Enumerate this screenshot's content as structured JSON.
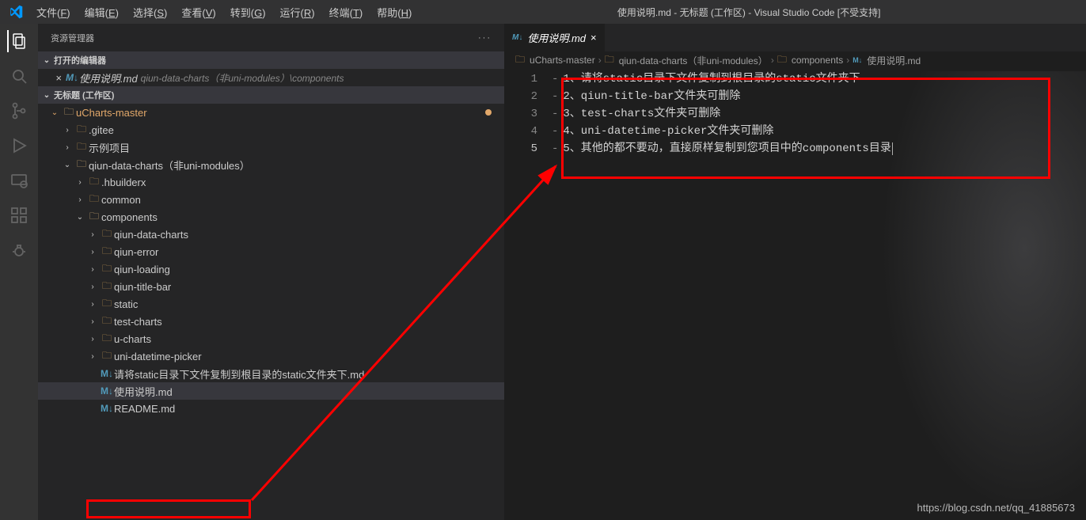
{
  "window": {
    "title": "使用说明.md - 无标题 (工作区) - Visual Studio Code [不受支持]"
  },
  "menu": [
    {
      "label": "文件",
      "mnemonic": "F"
    },
    {
      "label": "编辑",
      "mnemonic": "E"
    },
    {
      "label": "选择",
      "mnemonic": "S"
    },
    {
      "label": "查看",
      "mnemonic": "V"
    },
    {
      "label": "转到",
      "mnemonic": "G"
    },
    {
      "label": "运行",
      "mnemonic": "R"
    },
    {
      "label": "终端",
      "mnemonic": "T"
    },
    {
      "label": "帮助",
      "mnemonic": "H"
    }
  ],
  "sidebar": {
    "title": "资源管理器",
    "open_editors": "打开的编辑器",
    "workspace": "无标题 (工作区)",
    "open_file": {
      "name": "使用说明.md",
      "path": "qiun-data-charts（非uni-modules）\\components"
    }
  },
  "tree": {
    "root": "uCharts-master",
    "nodes": [
      {
        "depth": 1,
        "type": "folder",
        "name": ".gitee",
        "open": false
      },
      {
        "depth": 1,
        "type": "folder",
        "name": "示例项目",
        "open": false
      },
      {
        "depth": 1,
        "type": "folder",
        "name": "qiun-data-charts（非uni-modules）",
        "open": true
      },
      {
        "depth": 2,
        "type": "folder",
        "name": ".hbuilderx",
        "open": false
      },
      {
        "depth": 2,
        "type": "folder",
        "name": "common",
        "open": false
      },
      {
        "depth": 2,
        "type": "folder",
        "name": "components",
        "open": true
      },
      {
        "depth": 3,
        "type": "folder",
        "name": "qiun-data-charts",
        "open": false
      },
      {
        "depth": 3,
        "type": "folder",
        "name": "qiun-error",
        "open": false
      },
      {
        "depth": 3,
        "type": "folder",
        "name": "qiun-loading",
        "open": false
      },
      {
        "depth": 3,
        "type": "folder",
        "name": "qiun-title-bar",
        "open": false
      },
      {
        "depth": 3,
        "type": "folder",
        "name": "static",
        "open": false
      },
      {
        "depth": 3,
        "type": "folder",
        "name": "test-charts",
        "open": false
      },
      {
        "depth": 3,
        "type": "folder",
        "name": "u-charts",
        "open": false
      },
      {
        "depth": 3,
        "type": "folder",
        "name": "uni-datetime-picker",
        "open": false
      },
      {
        "depth": 3,
        "type": "md",
        "name": "请将static目录下文件复制到根目录的static文件夹下.md"
      },
      {
        "depth": 3,
        "type": "md",
        "name": "使用说明.md",
        "selected": true
      },
      {
        "depth": 3,
        "type": "md",
        "name": "README.md"
      }
    ]
  },
  "tab": {
    "name": "使用说明.md"
  },
  "breadcrumbs": [
    "uCharts-master",
    "qiun-data-charts（非uni-modules）",
    "components",
    "使用说明.md"
  ],
  "code": [
    "1、请将static目录下文件复制到根目录的static文件夹下",
    "2、qiun-title-bar文件夹可删除",
    "3、test-charts文件夹可删除",
    "4、uni-datetime-picker文件夹可删除",
    "5、其他的都不要动，直接原样复制到您项目中的components目录"
  ],
  "watermark": "https://blog.csdn.net/qq_41885673"
}
